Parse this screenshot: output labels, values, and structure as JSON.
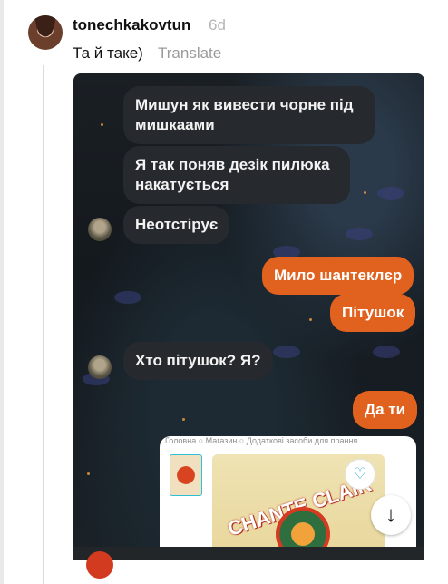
{
  "comment": {
    "username": "tonechkakovtun",
    "time": "6d",
    "text": "Та й таке)",
    "translate_label": "Translate"
  },
  "chat": {
    "messages": [
      {
        "from": "in",
        "text": "Мишун як вивести чорне під мишкаами"
      },
      {
        "from": "in",
        "text": "Я так поняв дезік пилюка накатується"
      },
      {
        "from": "in",
        "text": "Неотстірує"
      },
      {
        "from": "out",
        "text": "Мило шантеклєр"
      },
      {
        "from": "out",
        "text": "Пітушок"
      },
      {
        "from": "in",
        "text": "Хто пітушок? Я?"
      },
      {
        "from": "out",
        "text": "Да ти"
      }
    ],
    "product_card": {
      "breadcrumbs": "Головна  ○  Магазин  ○  Додаткові засоби для прання",
      "brand": "CHANTE CLAIR"
    }
  },
  "icons": {
    "heart": "heart-icon",
    "scroll_down": "arrow-down-icon"
  },
  "colors": {
    "outgoing_bubble": "#e1621f",
    "incoming_bubble": "#26292d",
    "muted_text": "#b5b5b5"
  }
}
